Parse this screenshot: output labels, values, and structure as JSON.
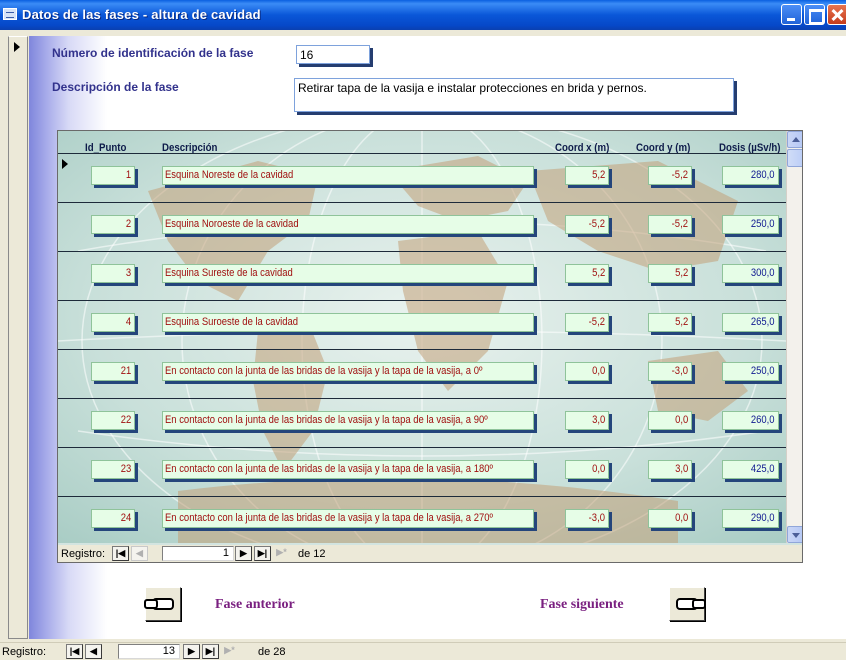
{
  "window": {
    "title": "Datos de las fases - altura de cavidad"
  },
  "form": {
    "phase_id_label": "Número de identificación de la fase",
    "phase_id_value": "16",
    "phase_desc_label": "Descripción de la fase",
    "phase_desc_value": "Retirar tapa de la vasija e instalar protecciones en brida y pernos."
  },
  "subform": {
    "columns": [
      "Id_Punto",
      "Descripción",
      "Coord x (m)",
      "Coord y (m)",
      "Dosis (µSv/h)"
    ],
    "rows": [
      {
        "id": "1",
        "desc": "Esquina Noreste de la cavidad",
        "x": "5,2",
        "y": "-5,2",
        "dose": "280,0"
      },
      {
        "id": "2",
        "desc": "Esquina Noroeste de la cavidad",
        "x": "-5,2",
        "y": "-5,2",
        "dose": "250,0"
      },
      {
        "id": "3",
        "desc": "Esquina Sureste de la cavidad",
        "x": "5,2",
        "y": "5,2",
        "dose": "300,0"
      },
      {
        "id": "4",
        "desc": "Esquina Suroeste de la cavidad",
        "x": "-5,2",
        "y": "5,2",
        "dose": "265,0"
      },
      {
        "id": "21",
        "desc": "En contacto con la junta de las bridas de la vasija y la tapa de la vasija, a 0º",
        "x": "0,0",
        "y": "-3,0",
        "dose": "250,0"
      },
      {
        "id": "22",
        "desc": "En contacto con la junta de las bridas de la vasija y la tapa de la vasija, a 90º",
        "x": "3,0",
        "y": "0,0",
        "dose": "260,0"
      },
      {
        "id": "23",
        "desc": "En contacto con la junta de las bridas de la vasija y la tapa de la vasija, a 180º",
        "x": "0,0",
        "y": "3,0",
        "dose": "425,0"
      },
      {
        "id": "24",
        "desc": "En contacto con la junta de las bridas de la vasija y la tapa de la vasija, a 270º",
        "x": "-3,0",
        "y": "0,0",
        "dose": "290,0"
      }
    ],
    "nav": {
      "label": "Registro:",
      "current": "1",
      "of_label": "de 12"
    }
  },
  "buttons": {
    "prev_label": "Fase anterior",
    "next_label": "Fase siguiente"
  },
  "main_nav": {
    "label": "Registro:",
    "current": "13",
    "of_label": "de 28"
  },
  "icons": {
    "title": "access-form-icon",
    "prev": "hand-pointing-left-icon",
    "next": "hand-pointing-right-icon",
    "first": "first-record-icon",
    "previous": "previous-record-icon",
    "nextrec": "next-record-icon",
    "last": "last-record-icon",
    "new": "new-record-icon"
  },
  "colors": {
    "title_bar": "#0a57d8",
    "label": "#32328c",
    "cell_bg": "#e6fde7",
    "cell_text": "#a01010",
    "dose_text": "#101a90",
    "button_label": "#7a2080"
  }
}
